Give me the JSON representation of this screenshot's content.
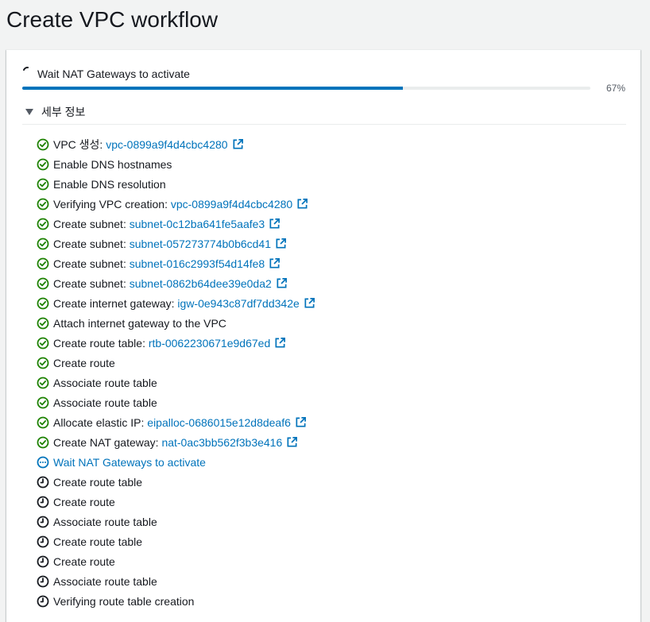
{
  "page": {
    "title": "Create VPC workflow"
  },
  "progress": {
    "label": "Wait NAT Gateways to activate",
    "percent": 67,
    "percent_text": "67%"
  },
  "details": {
    "label": "세부 정보"
  },
  "colors": {
    "success": "#1d8102",
    "progress": "#0073bb",
    "pending": "#16191f",
    "link": "#0073bb"
  },
  "steps": [
    {
      "label": "VPC 생성: ",
      "link": "vpc-0899a9f4d4cbc4280",
      "status": "success",
      "icon": "check-circle-icon"
    },
    {
      "label": "Enable DNS hostnames",
      "link": null,
      "status": "success",
      "icon": "check-circle-icon"
    },
    {
      "label": "Enable DNS resolution",
      "link": null,
      "status": "success",
      "icon": "check-circle-icon"
    },
    {
      "label": "Verifying VPC creation: ",
      "link": "vpc-0899a9f4d4cbc4280",
      "status": "success",
      "icon": "check-circle-icon"
    },
    {
      "label": "Create subnet: ",
      "link": "subnet-0c12ba641fe5aafe3",
      "status": "success",
      "icon": "check-circle-icon"
    },
    {
      "label": "Create subnet: ",
      "link": "subnet-057273774b0b6cd41",
      "status": "success",
      "icon": "check-circle-icon"
    },
    {
      "label": "Create subnet: ",
      "link": "subnet-016c2993f54d14fe8",
      "status": "success",
      "icon": "check-circle-icon"
    },
    {
      "label": "Create subnet: ",
      "link": "subnet-0862b64dee39e0da2",
      "status": "success",
      "icon": "check-circle-icon"
    },
    {
      "label": "Create internet gateway: ",
      "link": "igw-0e943c87df7dd342e",
      "status": "success",
      "icon": "check-circle-icon"
    },
    {
      "label": "Attach internet gateway to the VPC",
      "link": null,
      "status": "success",
      "icon": "check-circle-icon"
    },
    {
      "label": "Create route table: ",
      "link": "rtb-0062230671e9d67ed",
      "status": "success",
      "icon": "check-circle-icon"
    },
    {
      "label": "Create route",
      "link": null,
      "status": "success",
      "icon": "check-circle-icon"
    },
    {
      "label": "Associate route table",
      "link": null,
      "status": "success",
      "icon": "check-circle-icon"
    },
    {
      "label": "Associate route table",
      "link": null,
      "status": "success",
      "icon": "check-circle-icon"
    },
    {
      "label": "Allocate elastic IP: ",
      "link": "eipalloc-0686015e12d8deaf6",
      "status": "success",
      "icon": "check-circle-icon"
    },
    {
      "label": "Create NAT gateway: ",
      "link": "nat-0ac3bb562f3b3e416",
      "status": "success",
      "icon": "check-circle-icon"
    },
    {
      "label": "Wait NAT Gateways to activate",
      "link": null,
      "status": "in-progress",
      "icon": "ellipsis-circle-icon"
    },
    {
      "label": "Create route table",
      "link": null,
      "status": "pending",
      "icon": "clock-icon"
    },
    {
      "label": "Create route",
      "link": null,
      "status": "pending",
      "icon": "clock-icon"
    },
    {
      "label": "Associate route table",
      "link": null,
      "status": "pending",
      "icon": "clock-icon"
    },
    {
      "label": "Create route table",
      "link": null,
      "status": "pending",
      "icon": "clock-icon"
    },
    {
      "label": "Create route",
      "link": null,
      "status": "pending",
      "icon": "clock-icon"
    },
    {
      "label": "Associate route table",
      "link": null,
      "status": "pending",
      "icon": "clock-icon"
    },
    {
      "label": "Verifying route table creation",
      "link": null,
      "status": "pending",
      "icon": "clock-icon"
    }
  ]
}
